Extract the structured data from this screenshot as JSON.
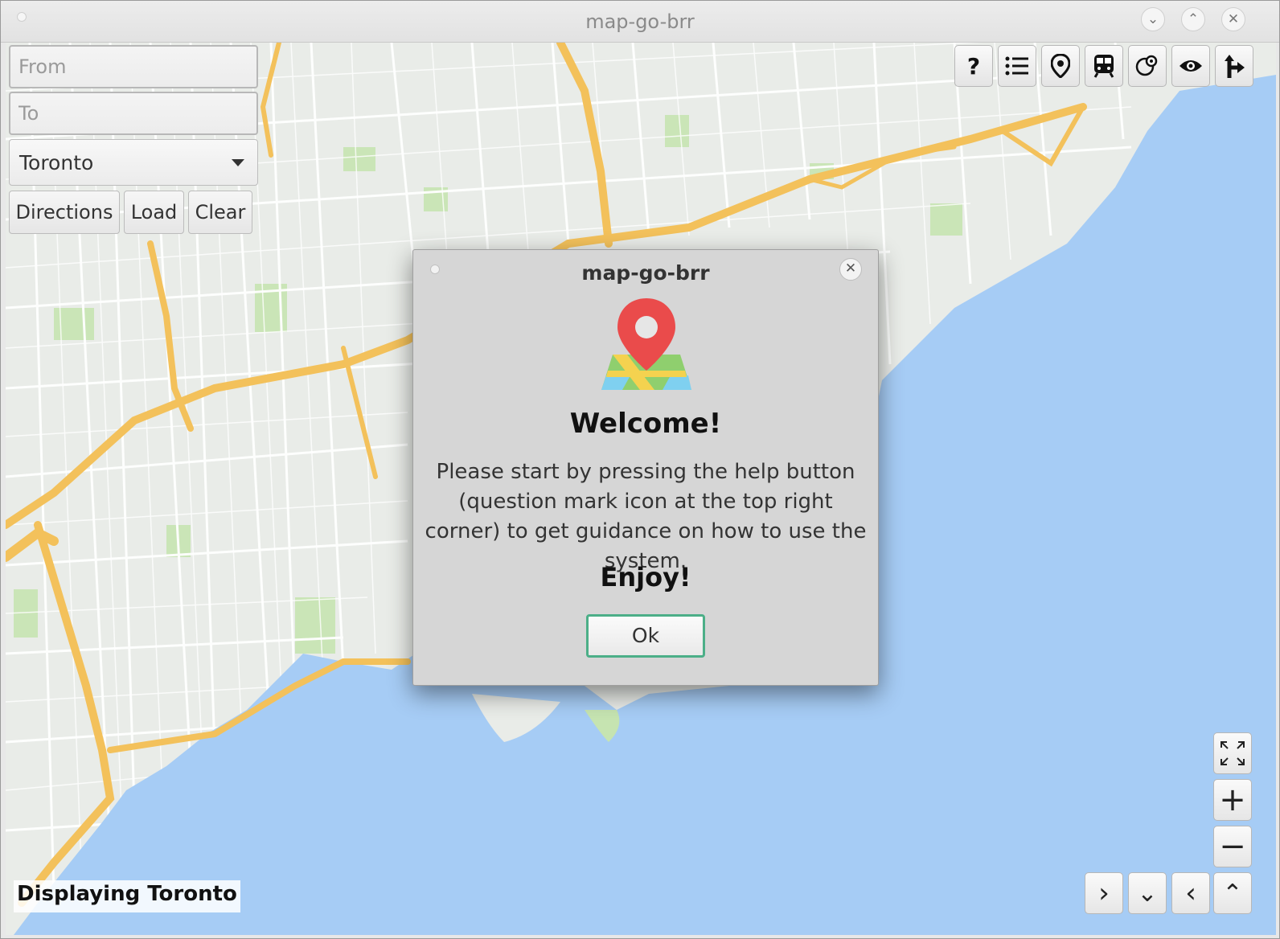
{
  "window": {
    "title": "map-go-brr",
    "controls": {
      "minimize": "⌄",
      "maximize": "⌃",
      "close": "✕"
    }
  },
  "search": {
    "from_placeholder": "From",
    "to_placeholder": "To",
    "city": "Toronto",
    "buttons": {
      "directions": "Directions",
      "load": "Load",
      "clear": "Clear"
    }
  },
  "toolbar": {
    "help": "?",
    "icons": [
      "help-icon",
      "list-icon",
      "location-pin-icon",
      "subway-icon",
      "poi-layers-icon",
      "eye-icon",
      "directions-turn-icon"
    ]
  },
  "nav": {
    "fullscreen_icon": "fullscreen-icon",
    "zoom_in": "+",
    "zoom_out": "−",
    "pan": [
      "›",
      "⌄",
      "‹",
      "⌃"
    ]
  },
  "status": {
    "text": "Displaying Toronto"
  },
  "dialog": {
    "title": "map-go-brr",
    "close": "✕",
    "welcome": "Welcome!",
    "message": "Please start by pressing the help button (question mark icon at the top right corner) to get guidance on how to use the system.",
    "enjoy": "Enjoy!",
    "ok": "Ok"
  },
  "colors": {
    "land": "#e9ece8",
    "water": "#a6ccf5",
    "highway": "#f3c15b",
    "park": "#c6e4b1",
    "ok_border": "#4caf88",
    "pin": "#ea4b4b"
  }
}
